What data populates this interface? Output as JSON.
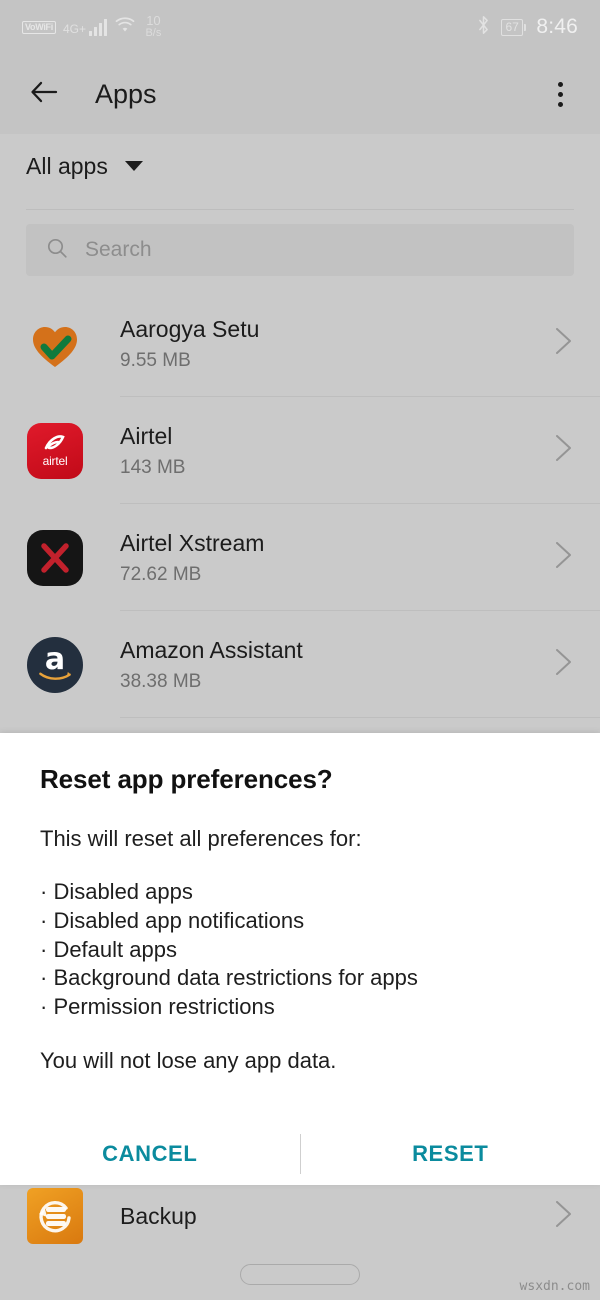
{
  "status_bar": {
    "vowifi_label": "VoWiFi",
    "network_type": "4G+",
    "data_rate_value": "10",
    "data_rate_unit": "B/s",
    "battery_level": "67",
    "time": "8:46"
  },
  "app_bar": {
    "title": "Apps"
  },
  "filter": {
    "label": "All apps"
  },
  "search": {
    "placeholder": "Search"
  },
  "app_list": [
    {
      "name": "Aarogya Setu",
      "size": "9.55 MB"
    },
    {
      "name": "Airtel",
      "size": "143 MB"
    },
    {
      "name": "Airtel Xstream",
      "size": "72.62 MB"
    },
    {
      "name": "Amazon Assistant",
      "size": "38.38 MB"
    }
  ],
  "background_row": {
    "name": "Backup"
  },
  "dialog": {
    "title": "Reset app preferences?",
    "body": "This will reset all preferences for:",
    "bullets": [
      "· Disabled apps",
      "· Disabled app notifications",
      "· Default apps",
      "· Background data restrictions for apps",
      "· Permission restrictions"
    ],
    "footnote": "You will not lose any app data.",
    "cancel_label": "CANCEL",
    "reset_label": "RESET",
    "action_color": "#0b8b9e"
  },
  "icon_labels": {
    "airtel_word": "airtel",
    "amazon_letter": "a"
  },
  "watermark": "wsxdn.com"
}
